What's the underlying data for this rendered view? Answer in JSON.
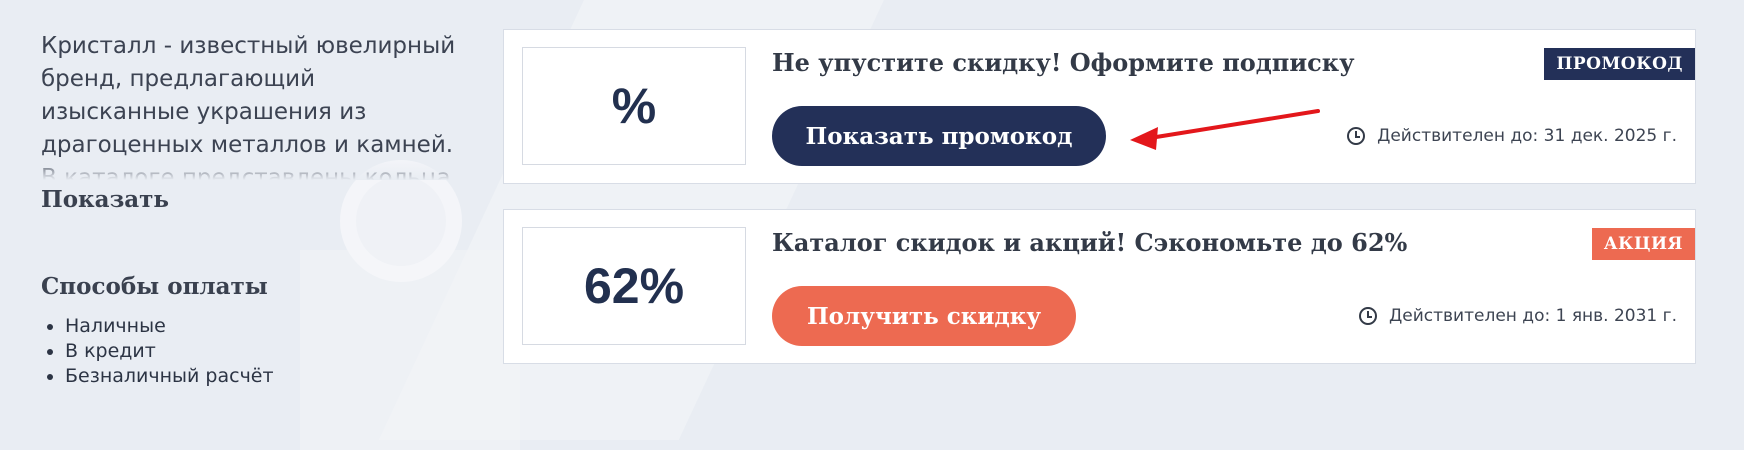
{
  "sidebar": {
    "description": "Кристалл - известный ювелирный бренд, предлагающий изысканные украшения из драгоценных металлов и камней. В каталоге представлены кольца, серьги",
    "show_more_label": "Показать",
    "payment_title": "Способы оплаты",
    "payment_methods": [
      "Наличные",
      "В кредит",
      "Безналичный расчёт"
    ]
  },
  "coupons": [
    {
      "image_text": "%",
      "title": "Не упустите скидку! Оформите подписку",
      "badge": "ПРОМОКОД",
      "button_label": "Показать промокод",
      "valid_until": "Действителен до: 31 дек. 2025 г."
    },
    {
      "image_text": "62%",
      "title": "Каталог скидок и акций! Сэкономьте до 62%",
      "badge": "АКЦИЯ",
      "button_label": "Получить скидку",
      "valid_until": "Действителен до: 1 янв. 2031 г."
    }
  ],
  "colors": {
    "navy": "#233058",
    "coral": "#ed6a51",
    "annotation_arrow": "#e3171b"
  },
  "icons": [
    "clock-icon",
    "arrow-annotation"
  ]
}
